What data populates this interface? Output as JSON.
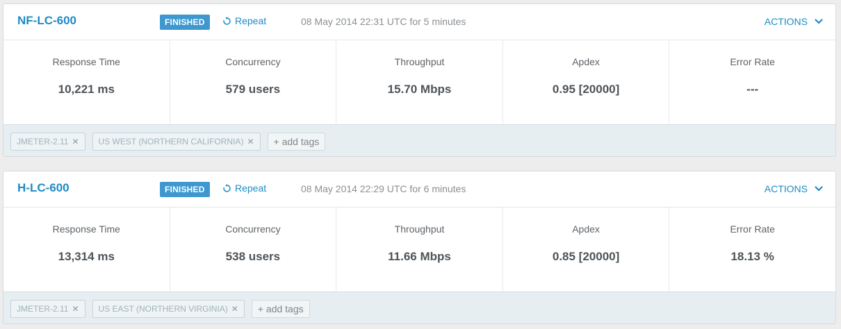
{
  "colors": {
    "accent": "#1e8bc3",
    "badge": "#3e98cf",
    "tag_bar": "#e6eef1",
    "value_text": "#4d5358"
  },
  "tests": [
    {
      "name": "NF-LC-600",
      "status": "FINISHED",
      "repeat_label": "Repeat",
      "run_info": "08 May 2014 22:31 UTC for 5 minutes",
      "actions_label": "ACTIONS",
      "metrics": [
        {
          "label": "Response Time",
          "value": "10,221 ms"
        },
        {
          "label": "Concurrency",
          "value": "579 users"
        },
        {
          "label": "Throughput",
          "value": "15.70 Mbps"
        },
        {
          "label": "Apdex",
          "value": "0.95 [20000]"
        },
        {
          "label": "Error Rate",
          "value": "---"
        }
      ],
      "tags": [
        "JMETER-2.11",
        "US WEST (NORTHERN CALIFORNIA)"
      ],
      "add_tags_label": "+ add tags"
    },
    {
      "name": "H-LC-600",
      "status": "FINISHED",
      "repeat_label": "Repeat",
      "run_info": "08 May 2014 22:29 UTC for 6 minutes",
      "actions_label": "ACTIONS",
      "metrics": [
        {
          "label": "Response Time",
          "value": "13,314 ms"
        },
        {
          "label": "Concurrency",
          "value": "538 users"
        },
        {
          "label": "Throughput",
          "value": "11.66 Mbps"
        },
        {
          "label": "Apdex",
          "value": "0.85 [20000]"
        },
        {
          "label": "Error Rate",
          "value": "18.13 %"
        }
      ],
      "tags": [
        "JMETER-2.11",
        "US EAST (NORTHERN VIRGINIA)"
      ],
      "add_tags_label": "+ add tags"
    }
  ]
}
